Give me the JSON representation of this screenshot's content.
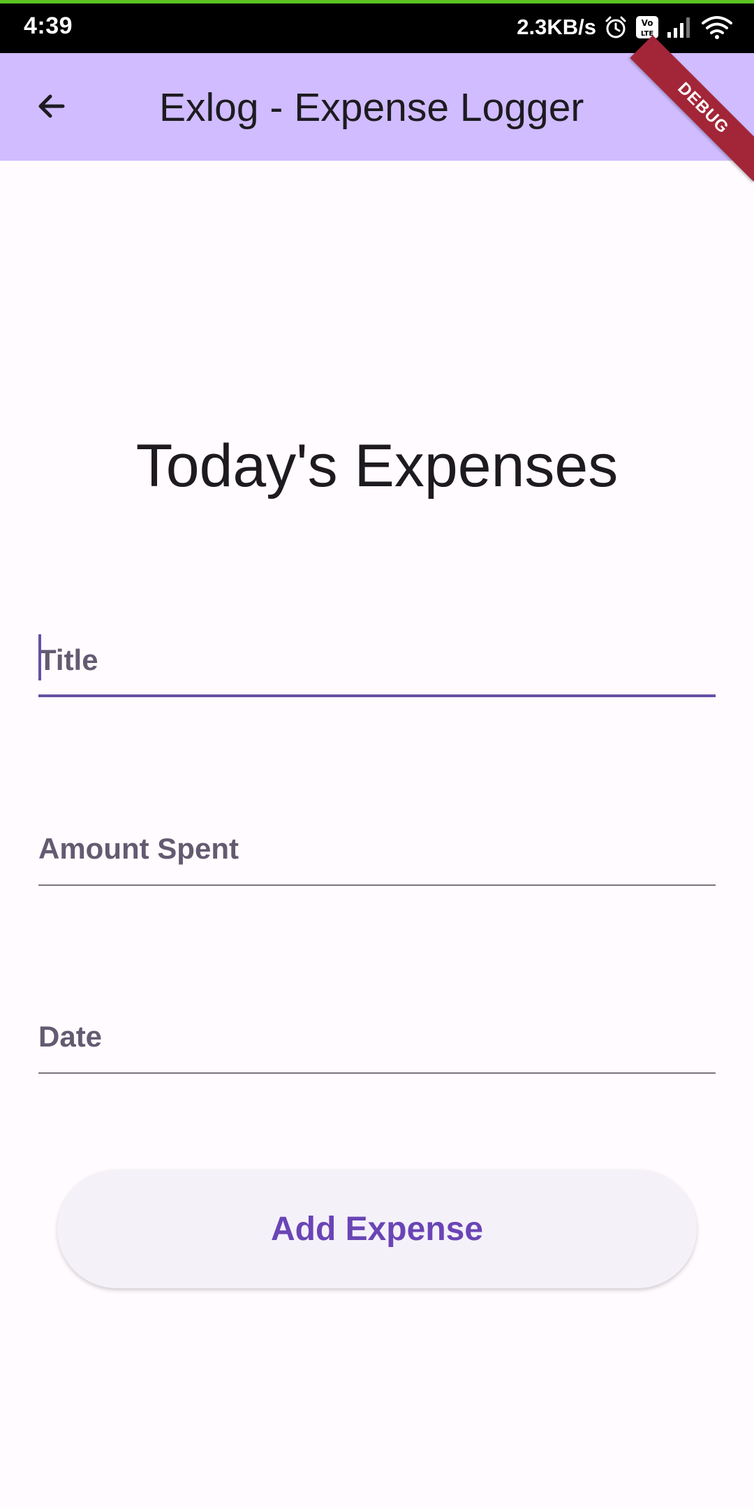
{
  "status_bar": {
    "time": "4:39",
    "net_speed": "2.3KB/s",
    "icons": [
      "alarm-icon",
      "volte-icon",
      "signal-icon",
      "wifi-icon"
    ],
    "accent_color": "#5cc323"
  },
  "app_bar": {
    "title": "Exlog - Expense Logger",
    "back_icon": "arrow-back-icon",
    "background": "#d0bcff"
  },
  "debug_banner": {
    "label": "DEBUG"
  },
  "main": {
    "heading": "Today's Expenses",
    "fields": {
      "title": {
        "placeholder": "Title",
        "value": ""
      },
      "amount": {
        "placeholder": "Amount Spent",
        "value": ""
      },
      "date": {
        "placeholder": "Date",
        "value": ""
      }
    },
    "submit_label": "Add Expense"
  },
  "colors": {
    "primary": "#6750a4",
    "button_text": "#6a45b5",
    "button_bg": "#f5f1f9"
  }
}
